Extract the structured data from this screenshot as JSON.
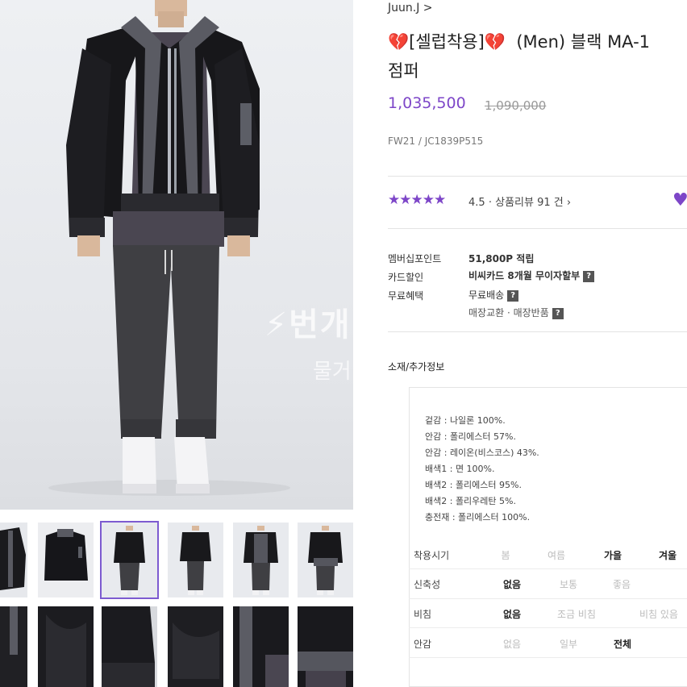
{
  "watermark": {
    "line1": "⚡번개",
    "line2": "물거"
  },
  "seller": "Juun.J >",
  "title": {
    "heart_emoji": "💔",
    "line1_bracket": "[셀럽착용]",
    "line1_rest": "(Men) 블랙 MA-1",
    "line2": "점퍼"
  },
  "price": {
    "sale": "1,035,500",
    "original": "1,090,000"
  },
  "product_code": "FW21 / JC1839P515",
  "review": {
    "stars": "★★★★★",
    "score": "4.5",
    "separator": "·",
    "label": "상품리뷰",
    "count": "91 건 ›"
  },
  "info_rows": [
    {
      "label": "멤버십포인트",
      "value": "51,800P 적립",
      "help": false
    },
    {
      "label": "카드할인",
      "value": "비씨카드 8개월 무이자할부",
      "help": true
    },
    {
      "label": "무료혜택",
      "value": "무료배송",
      "help": true
    }
  ],
  "extra_benefit": "매장교환 · 매장반품",
  "help_mark": "?",
  "section_title": "소재/추가정보",
  "materials": [
    "겉감 : 나일론 100%.",
    "안감 : 폴리에스터 57%.",
    "안감 : 레이온(비스코스) 43%.",
    "배색1 : 면 100%.",
    "배색2 : 폴리에스터 95%.",
    "배색2 : 폴리우레탄 5%.",
    "충전재 : 폴리에스터 100%."
  ],
  "attributes": [
    {
      "label": "착용시기",
      "options": [
        "봄",
        "여름",
        "가을",
        "겨울"
      ],
      "selected": [
        2,
        3
      ]
    },
    {
      "label": "신축성",
      "options": [
        "없음",
        "보통",
        "좋음"
      ],
      "selected": [
        0
      ]
    },
    {
      "label": "비침",
      "options": [
        "없음",
        "조금 비침",
        "비침 있음"
      ],
      "selected": [
        0
      ]
    },
    {
      "label": "안감",
      "options": [
        "없음",
        "일부",
        "전체"
      ],
      "selected": [
        2
      ]
    }
  ],
  "colors": {
    "accent": "#7d46c8",
    "heart": "#c0163e",
    "selected_thumb": "#7d5bd0"
  }
}
